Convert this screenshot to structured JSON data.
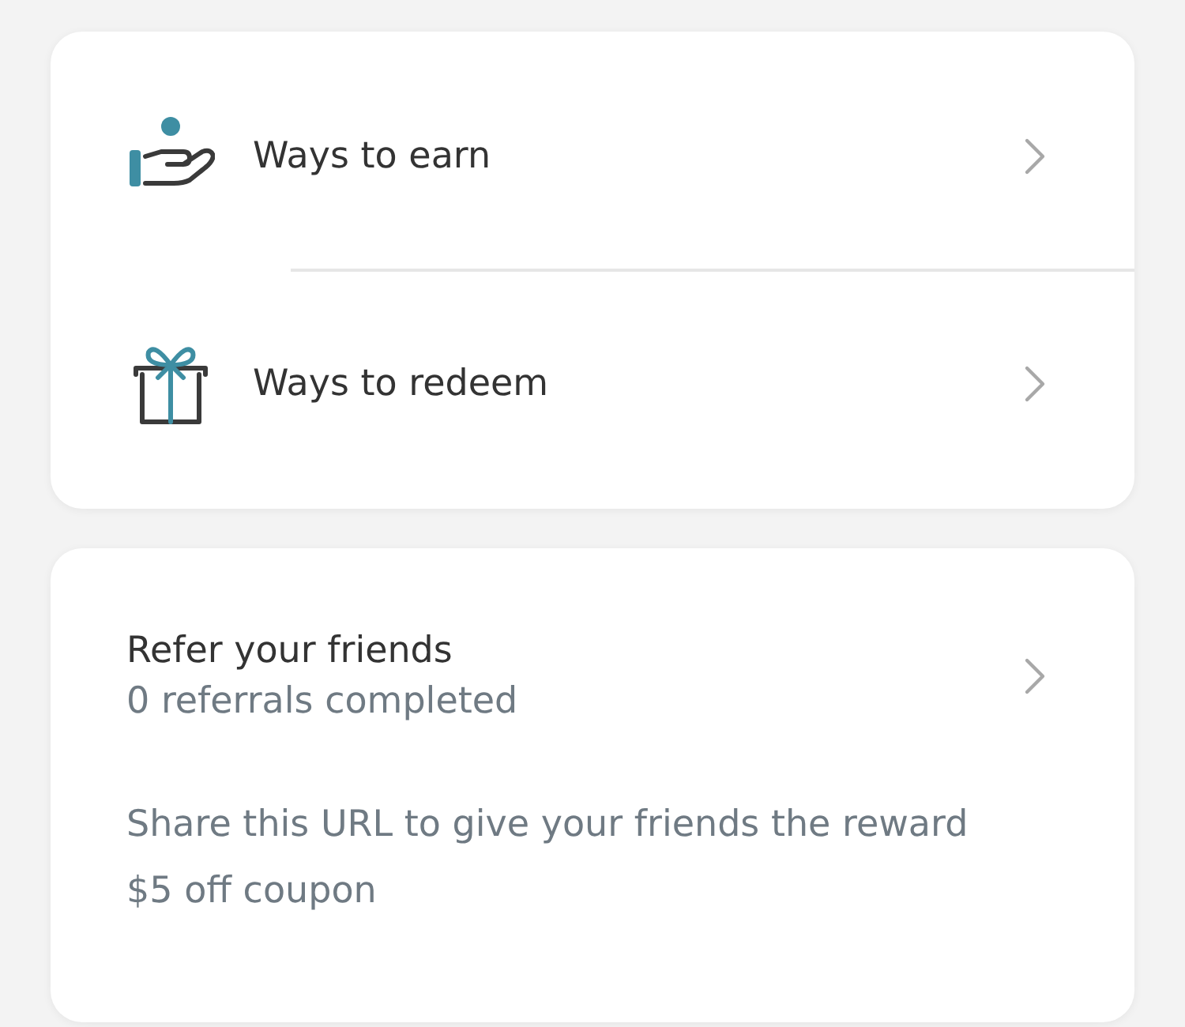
{
  "menu": [
    {
      "kind": "earn",
      "label": "Ways to earn"
    },
    {
      "kind": "redeem",
      "label": "Ways to redeem"
    }
  ],
  "referral": {
    "title": "Refer your friends",
    "subtitle": "0 referrals completed",
    "description": "Share this URL to give your friends the reward",
    "reward": "$5 off coupon"
  }
}
